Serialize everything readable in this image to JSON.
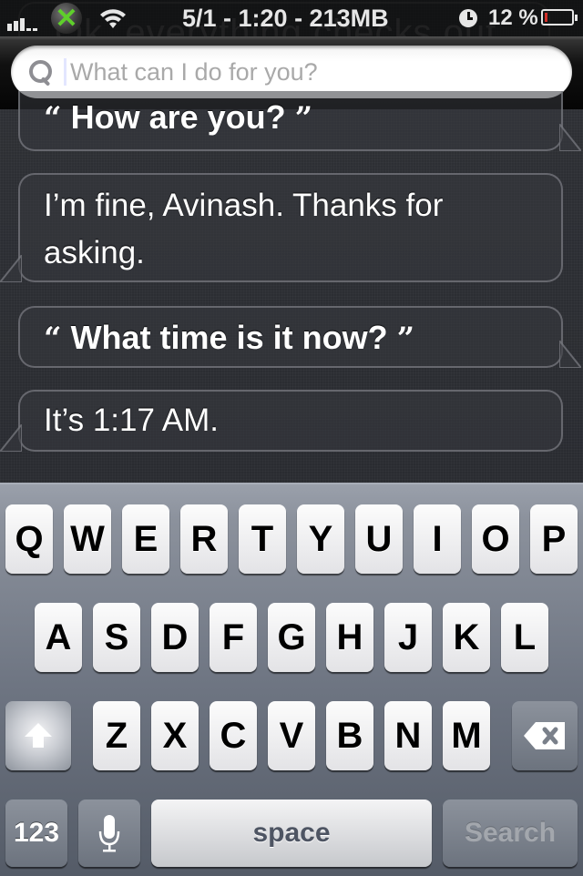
{
  "status_bar": {
    "carrier_icon": "signal-bars-icon",
    "app_icon": "xbox-icon",
    "wifi_icon": "wifi-icon",
    "center_text": "5/1 - 1:20 - 213MB",
    "alarm_icon": "clock-icon",
    "battery_percent": "12 %",
    "battery_level": 0.12,
    "battery_color": "#d1302a"
  },
  "ghost_text": "Ok, everything checks out",
  "search": {
    "placeholder": "What can I do for you?",
    "value": ""
  },
  "conversation": [
    {
      "speaker": "user",
      "open_quote": "“",
      "text": "How are you?",
      "close_quote": "”"
    },
    {
      "speaker": "siri",
      "text": "I’m fine, Avinash. Thanks for asking."
    },
    {
      "speaker": "user",
      "open_quote": "“",
      "text": "What time is it now?",
      "close_quote": "”"
    },
    {
      "speaker": "siri",
      "text": "It’s 1:17 AM."
    }
  ],
  "keyboard": {
    "row1": [
      "Q",
      "W",
      "E",
      "R",
      "T",
      "Y",
      "U",
      "I",
      "O",
      "P"
    ],
    "row2": [
      "A",
      "S",
      "D",
      "F",
      "G",
      "H",
      "J",
      "K",
      "L"
    ],
    "row3": [
      "Z",
      "X",
      "C",
      "V",
      "B",
      "N",
      "M"
    ],
    "shift_icon": "shift-arrow-icon",
    "delete_icon": "backspace-icon",
    "numbers_label": "123",
    "mic_icon": "microphone-icon",
    "space_label": "space",
    "search_label": "Search"
  }
}
